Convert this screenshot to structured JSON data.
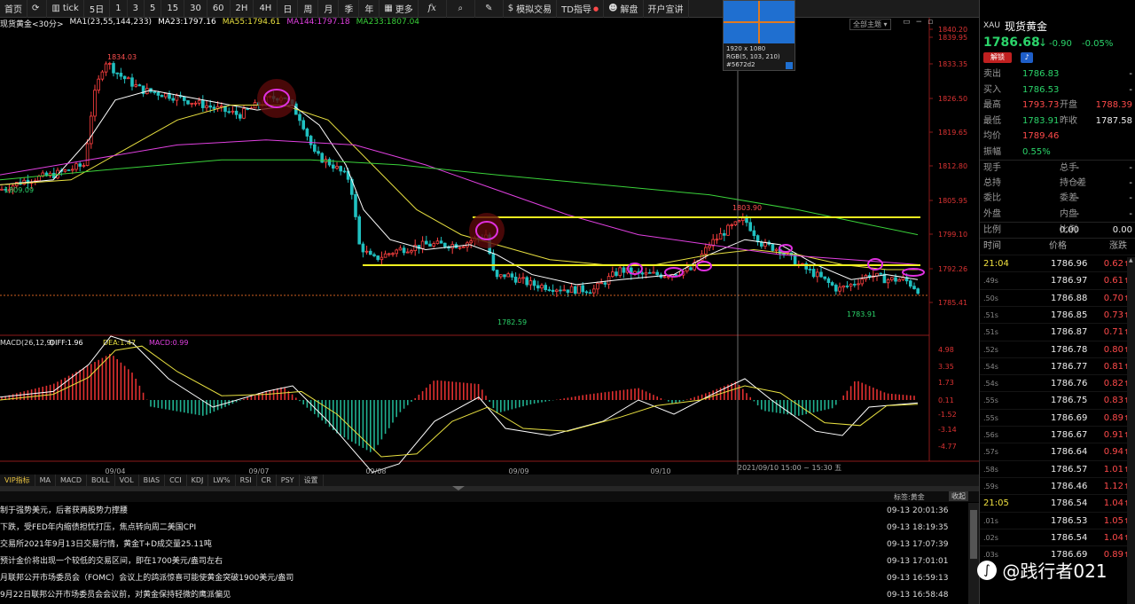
{
  "toolbar": {
    "home": "首页",
    "tick": "tick",
    "periods": [
      "5日",
      "1",
      "3",
      "5",
      "15",
      "30",
      "60",
      "2H",
      "4H",
      "日",
      "周",
      "月",
      "季",
      "年"
    ],
    "more": "更多",
    "draw_icon": "fx-icon",
    "sim_trade": "模拟交易",
    "td_index": "TD指导",
    "decode": "解盘",
    "open_account": "开户宣讲"
  },
  "chart_title": {
    "name": "现货黄金<30分>",
    "ma1": "MA1(23,55,144,233)",
    "ma23": "MA23:1797.16",
    "ma55": "MA55:1794.61",
    "ma144": "MA144:1797.18",
    "ma233": "MA233:1807.04",
    "theme": "全部主题"
  },
  "price_axis": [
    "1840.20",
    "1839.95",
    "1833.35",
    "1826.50",
    "1819.65",
    "1812.80",
    "1805.95",
    "1799.10",
    "1792.26",
    "1785.41"
  ],
  "price_labels": {
    "high": "1834.03",
    "low_left": "1809.09",
    "low_mid": "1782.59",
    "peak": "1803.90",
    "low_right": "1783.91"
  },
  "macd_title": {
    "name": "MACD(26,12,9)",
    "diff": "DIFF:1.96",
    "dea": "DEA:1.47",
    "macd": "MACD:0.99"
  },
  "macd_axis": [
    "4.98",
    "3.35",
    "1.73",
    "0.11",
    "-1.52",
    "-3.14",
    "-4.77"
  ],
  "x_axis": [
    "09/04",
    "09/07",
    "09/08",
    "09/09",
    "09/10",
    "2021/09/10 15:00 ~ 15:30 五"
  ],
  "magnifier": {
    "size": "1920 x 1080",
    "rgb": "RGB(5, 103, 210)",
    "hex": "#5672d2"
  },
  "tabs": [
    "VIP指标",
    "MA",
    "MACD",
    "BOLL",
    "VOL",
    "BIAS",
    "CCI",
    "KDJ",
    "LW%",
    "RSI",
    "CR",
    "PSY",
    "设置"
  ],
  "news_header": {
    "tag": "标签:黄金",
    "collapse": "收起"
  },
  "news": [
    {
      "title": "制于强势美元，后者获两股势力撑腰",
      "date": "09-13 20:01:36"
    },
    {
      "title": "下跌，受FED年内缩债担忧打压，焦点转向周二美国CPI",
      "date": "09-13 18:19:35"
    },
    {
      "title": "交易所2021年9月13日交易行情，黄金T+D成交量25.11吨",
      "date": "09-13 17:07:39"
    },
    {
      "title": "预计金价将出现一个较低的交易区间，即在1700美元/盎司左右",
      "date": "09-13 17:01:01"
    },
    {
      "title": "月联邦公开市场委员会（FOMC）会议上的鸽派惊喜可能使黄金突破1900美元/盎司",
      "date": "09-13 16:59:13"
    },
    {
      "title": "9月22日联邦公开市场委员会会议前，对黄金保持轻微的鹰派偏见",
      "date": "09-13 16:58:48"
    }
  ],
  "panel": {
    "symbol": "XAU",
    "name": "现货黄金",
    "price": "1786.68",
    "arrow": "↓",
    "change": "-0.90",
    "pct": "-0.05%",
    "badge": "解锁",
    "rows": [
      {
        "l": "卖出",
        "v": "1786.83",
        "l2": "",
        "v2": "-"
      },
      {
        "l": "买入",
        "v": "1786.53",
        "l2": "",
        "v2": "-"
      },
      {
        "l": "最高",
        "v": "1793.73",
        "l2": "开盘",
        "v2": "1788.39"
      },
      {
        "l": "最低",
        "v": "1783.91",
        "l2": "昨收",
        "v2": "1787.58"
      },
      {
        "l": "均价",
        "v": "1789.46",
        "l2": "",
        "v2": ""
      },
      {
        "l": "振幅",
        "v": "0.55%",
        "l2": "",
        "v2": ""
      },
      {
        "l": "现手",
        "v": "-",
        "l2": "总手",
        "v2": "-"
      },
      {
        "l": "总持",
        "v": "-",
        "l2": "持仓差",
        "v2": "-"
      },
      {
        "l": "委比",
        "v": "-",
        "l2": "委差",
        "v2": "-"
      },
      {
        "l": "外盘",
        "v": "-",
        "l2": "内盘",
        "v2": "-"
      },
      {
        "l": "比例",
        "v": "0.00",
        "l2": "比例",
        "v2": "0.00"
      }
    ],
    "tick_header": {
      "time": "时间",
      "price": "价格",
      "change": "涨跌"
    },
    "ticks": [
      {
        "t": "21:04",
        "p": "1786.96",
        "c": "0.62"
      },
      {
        "t": ".49s",
        "p": "1786.97",
        "c": "0.61"
      },
      {
        "t": ".50s",
        "p": "1786.88",
        "c": "0.70"
      },
      {
        "t": ".51s",
        "p": "1786.85",
        "c": "0.73"
      },
      {
        "t": ".51s",
        "p": "1786.87",
        "c": "0.71"
      },
      {
        "t": ".52s",
        "p": "1786.78",
        "c": "0.80"
      },
      {
        "t": ".54s",
        "p": "1786.77",
        "c": "0.81"
      },
      {
        "t": ".54s",
        "p": "1786.76",
        "c": "0.82"
      },
      {
        "t": ".55s",
        "p": "1786.75",
        "c": "0.83"
      },
      {
        "t": ".55s",
        "p": "1786.69",
        "c": "0.89"
      },
      {
        "t": ".56s",
        "p": "1786.67",
        "c": "0.91"
      },
      {
        "t": ".57s",
        "p": "1786.64",
        "c": "0.94"
      },
      {
        "t": ".58s",
        "p": "1786.57",
        "c": "1.01"
      },
      {
        "t": ".59s",
        "p": "1786.46",
        "c": "1.12"
      },
      {
        "t": "21:05",
        "p": "1786.54",
        "c": "1.04"
      },
      {
        "t": ".01s",
        "p": "1786.53",
        "c": "1.05"
      },
      {
        "t": ".02s",
        "p": "1786.54",
        "c": "1.04"
      },
      {
        "t": ".03s",
        "p": "1786.69",
        "c": "0.89"
      }
    ]
  },
  "watermark": "@践行者021"
}
